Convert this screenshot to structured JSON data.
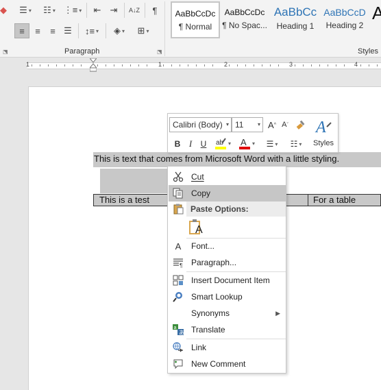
{
  "ribbon": {
    "group_paragraph": "Paragraph",
    "group_styles": "Styles",
    "pilcrow": "¶",
    "sort_glyph": "A↓Z",
    "styles_gallery": [
      {
        "sample": "AaBbCcDc",
        "name": "¶ Normal"
      },
      {
        "sample": "AaBbCcDc",
        "name": "¶ No Spac..."
      },
      {
        "sample": "AaBbCc",
        "name": "Heading 1"
      },
      {
        "sample": "AaBbCcD",
        "name": "Heading 2"
      }
    ],
    "styles_more": "A"
  },
  "ruler": {
    "numbers": [
      "1",
      "1",
      "2",
      "3",
      "4"
    ]
  },
  "document": {
    "paragraph": "This is text that comes from Microsoft Word with a little styling.",
    "table_row": [
      "This is a test",
      "",
      "For a table"
    ]
  },
  "mini_toolbar": {
    "font": "Calibri (Body)",
    "size": "11",
    "grow": "A",
    "shrink": "A",
    "bold": "B",
    "italic": "I",
    "underline": "U",
    "font_color": "A",
    "styles_label": "Styles",
    "highlight_color": "#ffff00",
    "font_color_bar": "#e00000"
  },
  "context_menu": {
    "items": [
      {
        "label": "Cut",
        "icon": "scissors-icon"
      },
      {
        "label": "Copy",
        "icon": "copy-icon"
      },
      {
        "label": "Paste Options:",
        "icon": "clipboard-icon"
      },
      {
        "label": "Font...",
        "icon": "font-icon"
      },
      {
        "label": "Paragraph...",
        "icon": "paragraph-icon"
      },
      {
        "label": "Insert Document Item",
        "icon": "insert-item-icon"
      },
      {
        "label": "Smart Lookup",
        "icon": "smart-lookup-icon"
      },
      {
        "label": "Synonyms",
        "icon": ""
      },
      {
        "label": "Translate",
        "icon": "translate-icon"
      },
      {
        "label": "Link",
        "icon": "link-icon"
      },
      {
        "label": "New Comment",
        "icon": "new-comment-icon"
      }
    ],
    "paste_option_glyph": "A"
  }
}
